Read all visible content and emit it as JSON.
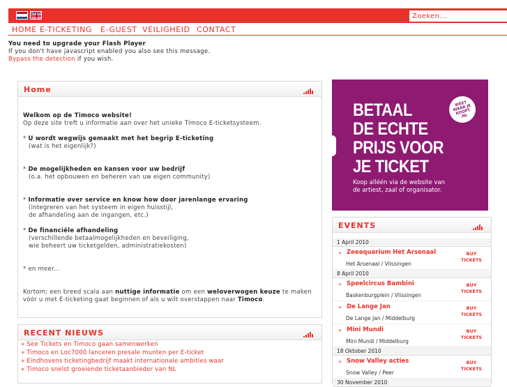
{
  "header": {
    "search_placeholder": "Zoeken..."
  },
  "nav": [
    "HOME",
    "E-TICKETING",
    "E-GUEST",
    "VEILIGHEID",
    "CONTACT"
  ],
  "flash": {
    "line1": "You need to upgrade your Flash Player",
    "line2": "If you don't have javascript enabled you also see this message.",
    "bypass_link": "Bypass the detection",
    "bypass_rest": " if you wish."
  },
  "home": {
    "title": "Home",
    "welcome": "Welkom op de Timoco website!",
    "intro": "Op deze site treft u informatie aan over het unieke Timoco E-ticketsysteem.",
    "b1_title": "U wordt wegwijs gemaakt met het begrip E-ticketing",
    "b1_sub": "(wat is het eigenlijk?)",
    "b2_title": "De mogelijkheden en kansen voor uw bedrijf",
    "b2_sub": "(o.a. het opbouwen en beheren van uw eigen community)",
    "b3_title": "Informatie over service en know how door jarenlange ervaring",
    "b3_sub1": "(integreren van het systeem in eigen huisstijl,",
    "b3_sub2": "de afhandeling aan de ingangen, etc.)",
    "b4_title": "De financiële afhandeling",
    "b4_sub1": "(verschillende betaalmogelijkheden en beveiliging,",
    "b4_sub2": "wie beheert uw ticketgelden, administratiekosten)",
    "more": "* en meer...",
    "closing_1": "Kortom; een breed scala aan ",
    "closing_b1": "nuttige informatie",
    "closing_2": " om een ",
    "closing_b2": "weloverwogen keuze",
    "closing_3": " te maken",
    "closing_4": "vóór u met E-ticketing gaat beginnen of als u wilt overstappen naar ",
    "closing_b3": "Timoco",
    "closing_5": "."
  },
  "news": {
    "title": "RECENT NIEUWS",
    "items": [
      "See Tickets en Timoco gaan samenwerken",
      "Timoco en Loc7000 lanceren presale munten per E-ticket",
      "Eindhovens ticketingbedrijf maakt internationale ambities waar",
      "Timoco snelst groeiende ticketaanbieder van NL"
    ]
  },
  "ad": {
    "line1": "BETAAL",
    "line2": "DE ECHTE",
    "line3": "PRIJS VOOR",
    "line4": "JE TICKET",
    "sub1": "Koop alléén via de website van",
    "sub2": "de artiest, zaal of organisator.",
    "stamp": "WEET WAAR JE KOOPT .NL"
  },
  "events": {
    "title": "EVENTS",
    "buy": "BUY TICKETS",
    "dates": [
      "1 April 2010",
      "8 April 2010",
      "18 Oktober 2010",
      "30 November 2010"
    ],
    "items": [
      {
        "name": "Zeeaquarium Het Arsenaal",
        "venue": "Het Arsenaal / Vlissingen"
      },
      {
        "name": "Speelcircus Bambini",
        "venue": "Baskenburgplein / Vlissingen"
      },
      {
        "name": "De Lange Jan",
        "venue": "De Lange Jan / Middelburg"
      },
      {
        "name": "Mini Mundi",
        "venue": "Mini Mundi / Middelburg"
      },
      {
        "name": "Snow Valley acties",
        "venue": "Snow Valley / Peer"
      }
    ]
  },
  "colors": {
    "accent": "#e8312b",
    "ad_bg": "#8e1a72"
  }
}
